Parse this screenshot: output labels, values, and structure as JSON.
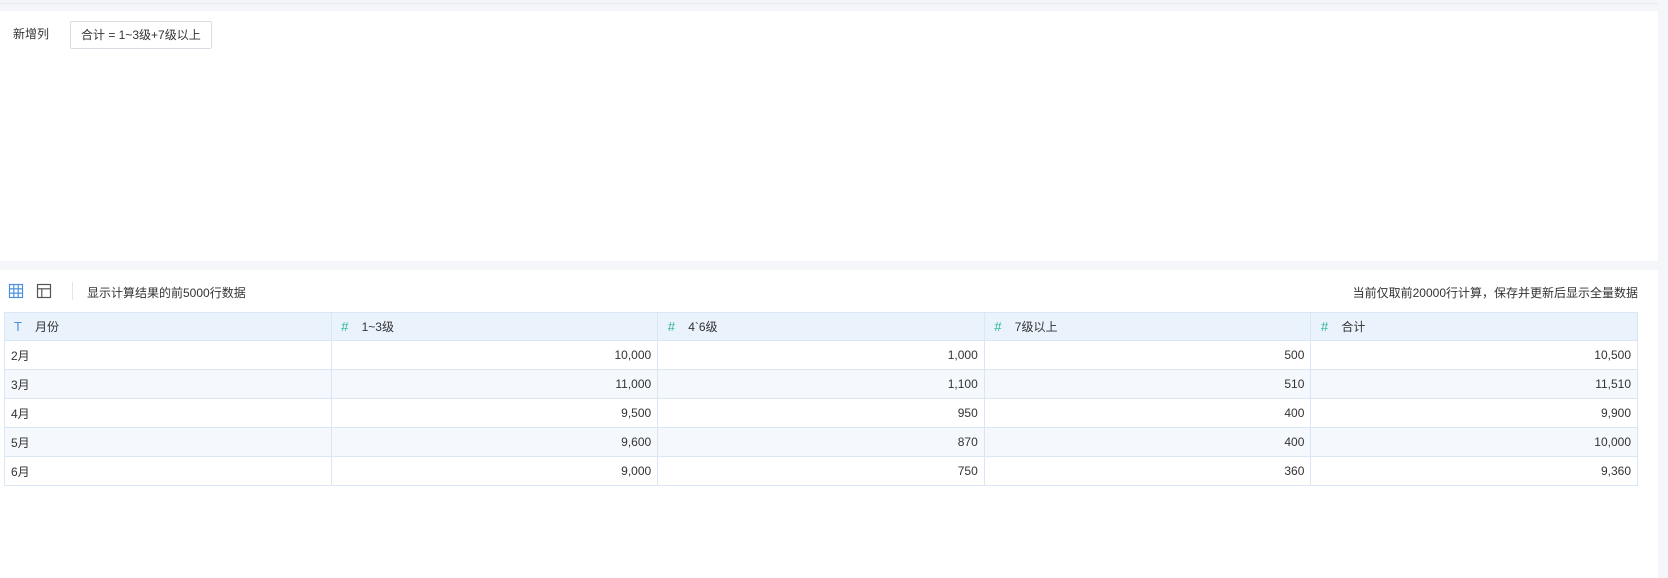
{
  "upper": {
    "new_column_label": "新增列",
    "formula_chip": "合计 = 1~3级+7级以上"
  },
  "toolbar": {
    "table_view_icon": "grid-table-icon",
    "layout_view_icon": "layout-table-icon",
    "left_text": "显示计算结果的前5000行数据",
    "right_text": "当前仅取前20000行计算，保存并更新后显示全量数据"
  },
  "colors": {
    "accent": "#4a8fe0",
    "number_icon": "#2bb39a",
    "header_bg": "#eaf2fc",
    "border": "#d9e6f5"
  },
  "table": {
    "columns": [
      {
        "type_icon": "T",
        "type": "text",
        "label": "月份"
      },
      {
        "type_icon": "#",
        "type": "number",
        "label": "1~3级"
      },
      {
        "type_icon": "#",
        "type": "number",
        "label": "4`6级"
      },
      {
        "type_icon": "#",
        "type": "number",
        "label": "7级以上"
      },
      {
        "type_icon": "#",
        "type": "number",
        "label": "合计"
      }
    ],
    "rows": [
      [
        "2月",
        "10,000",
        "1,000",
        "500",
        "10,500"
      ],
      [
        "3月",
        "11,000",
        "1,100",
        "510",
        "11,510"
      ],
      [
        "4月",
        "9,500",
        "950",
        "400",
        "9,900"
      ],
      [
        "5月",
        "9,600",
        "870",
        "400",
        "10,000"
      ],
      [
        "6月",
        "9,000",
        "750",
        "360",
        "9,360"
      ]
    ]
  }
}
